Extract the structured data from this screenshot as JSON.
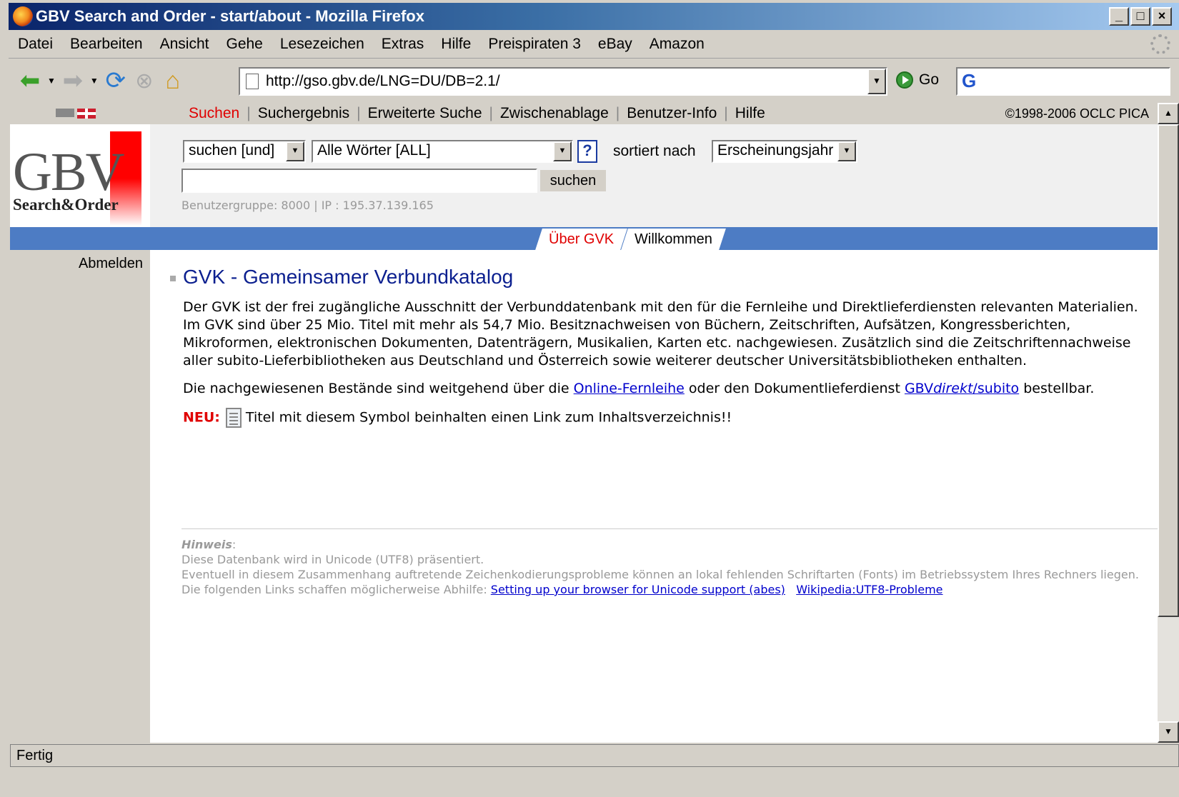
{
  "window": {
    "title": "GBV Search and Order - start/about - Mozilla Firefox",
    "buttons": [
      "_",
      "□",
      "×"
    ]
  },
  "menu": [
    "Datei",
    "Bearbeiten",
    "Ansicht",
    "Gehe",
    "Lesezeichen",
    "Extras",
    "Hilfe",
    "Preispiraten 3",
    "eBay",
    "Amazon"
  ],
  "toolbar": {
    "url": "http://gso.gbv.de/LNG=DU/DB=2.1/",
    "go_label": "Go",
    "search_logo": "G"
  },
  "topnav": {
    "items": [
      "Suchen",
      "Suchergebnis",
      "Erweiterte Suche",
      "Zwischenablage",
      "Benutzer-Info",
      "Hilfe"
    ],
    "copyright": "©1998-2006 OCLC PICA"
  },
  "logo": {
    "big": "GBV",
    "sub": "Search&Order"
  },
  "search": {
    "mode": "suchen [und]",
    "field": "Alle Wörter [ALL]",
    "help": "?",
    "sort_label": "sortiert nach",
    "sort_value": "Erscheinungsjahr",
    "query": "",
    "button": "suchen",
    "user_info": "Benutzergruppe: 8000 | IP : 195.37.139.165"
  },
  "tabs": [
    "Über GVK",
    "Willkommen"
  ],
  "sidebar": {
    "logout": "Abmelden"
  },
  "main": {
    "title": "GVK - Gemeinsamer Verbundkatalog",
    "para1": "Der GVK ist der frei zugängliche Ausschnitt der Verbunddatenbank mit den für die Fernleihe und Direktlieferdiensten relevanten Materialien. Im GVK sind über 25 Mio. Titel mit mehr als 54,7 Mio. Besitznachweisen von Büchern, Zeitschriften, Aufsätzen, Kongressberichten, Mikroformen, elektronischen Dokumenten, Datenträgern, Musikalien, Karten etc. nachgewiesen. Zusätzlich sind die Zeitschriftennachweise aller subito-Lieferbibliotheken aus Deutschland und Österreich sowie weiterer deutscher Universitätsbibliotheken enthalten.",
    "para2_a": "Die nachgewiesenen Bestände sind weitgehend über die ",
    "link_fernleihe": "Online-Fernleihe",
    "para2_b": " oder den Dokumentlieferdienst ",
    "link_gbv_a": "GBV",
    "link_gbv_b": "direkt",
    "link_gbv_c": "/subito",
    "para2_c": " bestellbar.",
    "neu": "NEU:",
    "neu_text": "Titel mit diesem Symbol beinhalten einen Link zum Inhaltsverzeichnis!!"
  },
  "hinweis": {
    "label": "Hinweis",
    "line1": "Diese Datenbank wird in Unicode (UTF8) präsentiert.",
    "line2": "Eventuell in diesem Zusammenhang auftretende Zeichenkodierungsprobleme können an lokal fehlenden Schriftarten (Fonts) im Betriebssystem Ihres Rechners liegen.",
    "line3": "Die folgenden Links schaffen möglicherweise Abhilfe: ",
    "link1": "Setting up your browser for Unicode support (abes)",
    "link2": "Wikipedia:UTF8-Probleme"
  },
  "status": "Fertig",
  "colors": {
    "accent_red": "#e00000",
    "blue_bar": "#4d7cc4",
    "title_blue": "#0b1f8f"
  }
}
